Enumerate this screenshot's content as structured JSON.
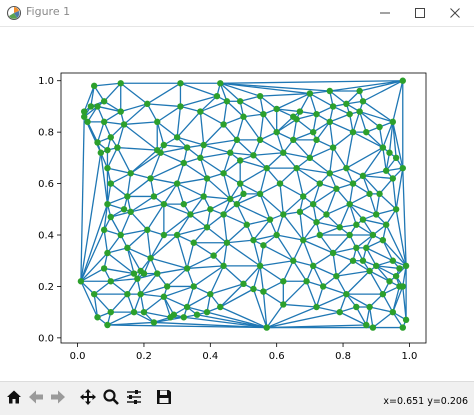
{
  "window": {
    "title": "Figure 1",
    "controls": [
      "minimize",
      "maximize",
      "close"
    ]
  },
  "toolbar": {
    "buttons": [
      {
        "name": "home",
        "icon": "home-icon"
      },
      {
        "name": "back",
        "icon": "arrow-left-icon"
      },
      {
        "name": "forward",
        "icon": "arrow-right-icon"
      },
      {
        "name": "pan",
        "icon": "move-icon"
      },
      {
        "name": "zoom",
        "icon": "magnifier-icon"
      },
      {
        "name": "configure-subplots",
        "icon": "sliders-icon"
      },
      {
        "name": "save",
        "icon": "floppy-icon"
      }
    ],
    "coordinate_readout": "x=0.651  y=0.206"
  },
  "colors": {
    "edge": "#1f77b4",
    "point": "#2ca02c",
    "titlebar_text": "#8a8a8a",
    "toolbar_bg": "#f0f0f0"
  },
  "chart_data": {
    "type": "scatter",
    "description_free": "",
    "x_ticks": [
      "0.0",
      "0.2",
      "0.4",
      "0.6",
      "0.8",
      "1.0"
    ],
    "y_ticks": [
      "0.0",
      "0.2",
      "0.4",
      "0.6",
      "0.8",
      "1.0"
    ],
    "xlim": [
      -0.05,
      1.05
    ],
    "ylim": [
      -0.02,
      1.03
    ],
    "grid": false,
    "series": [
      {
        "marker": "o",
        "points": [
          [
            0.01,
            0.22
          ],
          [
            0.02,
            0.86
          ],
          [
            0.02,
            0.88
          ],
          [
            0.03,
            0.84
          ],
          [
            0.04,
            0.9
          ],
          [
            0.05,
            0.98
          ],
          [
            0.06,
            0.9
          ],
          [
            0.08,
            0.92
          ],
          [
            0.08,
            0.84
          ],
          [
            0.1,
            0.78
          ],
          [
            0.06,
            0.76
          ],
          [
            0.07,
            0.72
          ],
          [
            0.09,
            0.73
          ],
          [
            0.09,
            0.66
          ],
          [
            0.1,
            0.6
          ],
          [
            0.09,
            0.52
          ],
          [
            0.1,
            0.47
          ],
          [
            0.08,
            0.42
          ],
          [
            0.09,
            0.33
          ],
          [
            0.08,
            0.27
          ],
          [
            0.1,
            0.22
          ],
          [
            0.05,
            0.17
          ],
          [
            0.06,
            0.08
          ],
          [
            0.09,
            0.05
          ],
          [
            0.1,
            0.1
          ],
          [
            0.13,
            0.99
          ],
          [
            0.13,
            0.88
          ],
          [
            0.14,
            0.83
          ],
          [
            0.12,
            0.74
          ],
          [
            0.16,
            0.64
          ],
          [
            0.15,
            0.55
          ],
          [
            0.14,
            0.5
          ],
          [
            0.16,
            0.49
          ],
          [
            0.13,
            0.4
          ],
          [
            0.15,
            0.35
          ],
          [
            0.17,
            0.25
          ],
          [
            0.18,
            0.23
          ],
          [
            0.19,
            0.26
          ],
          [
            0.2,
            0.25
          ],
          [
            0.19,
            0.17
          ],
          [
            0.2,
            0.1
          ],
          [
            0.23,
            0.06
          ],
          [
            0.15,
            0.17
          ],
          [
            0.17,
            0.1
          ],
          [
            0.21,
            0.91
          ],
          [
            0.24,
            0.84
          ],
          [
            0.25,
            0.72
          ],
          [
            0.24,
            0.73
          ],
          [
            0.26,
            0.75
          ],
          [
            0.22,
            0.62
          ],
          [
            0.23,
            0.55
          ],
          [
            0.26,
            0.52
          ],
          [
            0.21,
            0.42
          ],
          [
            0.26,
            0.4
          ],
          [
            0.22,
            0.31
          ],
          [
            0.24,
            0.25
          ],
          [
            0.27,
            0.2
          ],
          [
            0.26,
            0.16
          ],
          [
            0.29,
            0.09
          ],
          [
            0.28,
            0.08
          ],
          [
            0.31,
            0.99
          ],
          [
            0.31,
            0.9
          ],
          [
            0.3,
            0.78
          ],
          [
            0.33,
            0.74
          ],
          [
            0.32,
            0.68
          ],
          [
            0.3,
            0.6
          ],
          [
            0.32,
            0.52
          ],
          [
            0.34,
            0.48
          ],
          [
            0.3,
            0.4
          ],
          [
            0.35,
            0.37
          ],
          [
            0.33,
            0.27
          ],
          [
            0.35,
            0.2
          ],
          [
            0.33,
            0.12
          ],
          [
            0.36,
            0.09
          ],
          [
            0.32,
            0.08
          ],
          [
            0.37,
            0.88
          ],
          [
            0.38,
            0.75
          ],
          [
            0.37,
            0.7
          ],
          [
            0.39,
            0.62
          ],
          [
            0.38,
            0.55
          ],
          [
            0.4,
            0.5
          ],
          [
            0.39,
            0.43
          ],
          [
            0.41,
            0.32
          ],
          [
            0.4,
            0.17
          ],
          [
            0.39,
            0.1
          ],
          [
            0.43,
            0.99
          ],
          [
            0.42,
            0.94
          ],
          [
            0.45,
            0.92
          ],
          [
            0.44,
            0.83
          ],
          [
            0.46,
            0.72
          ],
          [
            0.44,
            0.64
          ],
          [
            0.46,
            0.54
          ],
          [
            0.44,
            0.48
          ],
          [
            0.45,
            0.37
          ],
          [
            0.44,
            0.28
          ],
          [
            0.43,
            0.12
          ],
          [
            0.49,
            0.92
          ],
          [
            0.5,
            0.86
          ],
          [
            0.48,
            0.77
          ],
          [
            0.49,
            0.69
          ],
          [
            0.49,
            0.6
          ],
          [
            0.5,
            0.56
          ],
          [
            0.48,
            0.52
          ],
          [
            0.51,
            0.44
          ],
          [
            0.53,
            0.38
          ],
          [
            0.5,
            0.21
          ],
          [
            0.53,
            0.19
          ],
          [
            0.55,
            0.94
          ],
          [
            0.56,
            0.87
          ],
          [
            0.55,
            0.77
          ],
          [
            0.53,
            0.71
          ],
          [
            0.57,
            0.66
          ],
          [
            0.55,
            0.56
          ],
          [
            0.58,
            0.46
          ],
          [
            0.56,
            0.36
          ],
          [
            0.55,
            0.28
          ],
          [
            0.56,
            0.18
          ],
          [
            0.57,
            0.04
          ],
          [
            0.6,
            0.89
          ],
          [
            0.6,
            0.8
          ],
          [
            0.62,
            0.72
          ],
          [
            0.61,
            0.6
          ],
          [
            0.62,
            0.48
          ],
          [
            0.6,
            0.4
          ],
          [
            0.62,
            0.22
          ],
          [
            0.62,
            0.13
          ],
          [
            0.65,
            0.86
          ],
          [
            0.66,
            0.85
          ],
          [
            0.67,
            0.88
          ],
          [
            0.65,
            0.77
          ],
          [
            0.66,
            0.66
          ],
          [
            0.68,
            0.55
          ],
          [
            0.67,
            0.49
          ],
          [
            0.68,
            0.38
          ],
          [
            0.65,
            0.3
          ],
          [
            0.69,
            0.22
          ],
          [
            0.7,
            0.95
          ],
          [
            0.72,
            0.87
          ],
          [
            0.71,
            0.8
          ],
          [
            0.72,
            0.77
          ],
          [
            0.7,
            0.7
          ],
          [
            0.73,
            0.6
          ],
          [
            0.71,
            0.52
          ],
          [
            0.72,
            0.45
          ],
          [
            0.73,
            0.4
          ],
          [
            0.71,
            0.28
          ],
          [
            0.74,
            0.2
          ],
          [
            0.72,
            0.12
          ],
          [
            0.76,
            0.96
          ],
          [
            0.77,
            0.9
          ],
          [
            0.76,
            0.84
          ],
          [
            0.77,
            0.74
          ],
          [
            0.76,
            0.64
          ],
          [
            0.78,
            0.58
          ],
          [
            0.75,
            0.48
          ],
          [
            0.79,
            0.43
          ],
          [
            0.77,
            0.33
          ],
          [
            0.78,
            0.24
          ],
          [
            0.79,
            0.1
          ],
          [
            0.81,
            0.91
          ],
          [
            0.82,
            0.87
          ],
          [
            0.83,
            0.8
          ],
          [
            0.81,
            0.66
          ],
          [
            0.83,
            0.6
          ],
          [
            0.82,
            0.52
          ],
          [
            0.84,
            0.44
          ],
          [
            0.82,
            0.4
          ],
          [
            0.84,
            0.35
          ],
          [
            0.83,
            0.3
          ],
          [
            0.81,
            0.17
          ],
          [
            0.84,
            0.12
          ],
          [
            0.85,
            0.96
          ],
          [
            0.86,
            0.92
          ],
          [
            0.85,
            0.88
          ],
          [
            0.87,
            0.8
          ],
          [
            0.86,
            0.63
          ],
          [
            0.88,
            0.56
          ],
          [
            0.86,
            0.46
          ],
          [
            0.89,
            0.4
          ],
          [
            0.87,
            0.35
          ],
          [
            0.86,
            0.3
          ],
          [
            0.88,
            0.26
          ],
          [
            0.89,
            0.04
          ],
          [
            0.87,
            0.05
          ],
          [
            0.88,
            0.12
          ],
          [
            0.91,
            0.82
          ],
          [
            0.92,
            0.74
          ],
          [
            0.93,
            0.65
          ],
          [
            0.91,
            0.56
          ],
          [
            0.9,
            0.48
          ],
          [
            0.93,
            0.44
          ],
          [
            0.92,
            0.38
          ],
          [
            0.9,
            0.28
          ],
          [
            0.94,
            0.22
          ],
          [
            0.92,
            0.17
          ],
          [
            0.95,
            0.84
          ],
          [
            0.94,
            0.72
          ],
          [
            0.96,
            0.7
          ],
          [
            0.95,
            0.62
          ],
          [
            0.96,
            0.5
          ],
          [
            0.95,
            0.3
          ],
          [
            0.97,
            0.27
          ],
          [
            0.96,
            0.24
          ],
          [
            0.97,
            0.2
          ],
          [
            0.95,
            0.1
          ],
          [
            0.98,
            1.0
          ],
          [
            0.98,
            0.66
          ],
          [
            0.99,
            0.28
          ],
          [
            0.98,
            0.2
          ],
          [
            0.99,
            0.07
          ],
          [
            0.98,
            0.04
          ]
        ]
      }
    ]
  }
}
